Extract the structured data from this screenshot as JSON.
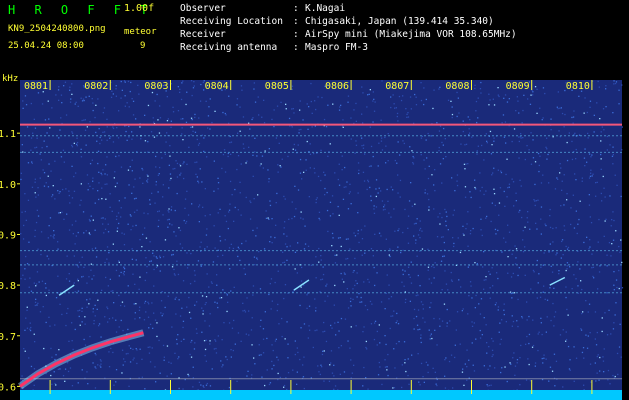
{
  "header": {
    "brand": "H R O F F T",
    "version": "1.00f",
    "filename": "KN9_2504240800.png",
    "meteor_label": "meteor",
    "datetime": "25.04.24 08:00",
    "meteor_count": "9",
    "info": [
      {
        "key": "Observer",
        "value": "K.Nagai"
      },
      {
        "key": "Receiving Location",
        "value": "Chigasaki, Japan (139.414 35.340)"
      },
      {
        "key": "Receiver",
        "value": "AirSpy mini (Miakejima VOR 108.65MHz)"
      },
      {
        "key": "Receiving antenna",
        "value": "Maspro FM-3"
      }
    ]
  },
  "chart_data": {
    "type": "heatmap",
    "title": "",
    "xlabel": "",
    "ylabel": "kHz",
    "x_tick_labels": [
      "0801",
      "0802",
      "0803",
      "0804",
      "0805",
      "0806",
      "0807",
      "0808",
      "0809",
      "0810"
    ],
    "y_tick_labels": [
      "1.1",
      "1.0",
      "0.9",
      "0.8",
      "0.7",
      "0.6"
    ],
    "y_ticks": [
      1.1,
      1.0,
      0.9,
      0.8,
      0.7,
      0.6
    ],
    "ylim": [
      0.585,
      1.205
    ],
    "xlim": [
      0.5,
      10.5
    ],
    "background_color": "#1a2a7a",
    "noise_color": "#3a6cd8",
    "grid_color": "#c8c8c8",
    "tick_color": "#ffff33",
    "horizontal_lines_khz": [
      1.117,
      1.095,
      1.062,
      0.868,
      0.84,
      0.785,
      0.615
    ],
    "strong_carrier_khz": 1.117,
    "meteor_trace": {
      "color": "#ff3366",
      "points": [
        [
          0.5,
          0.6
        ],
        [
          0.8,
          0.625
        ],
        [
          1.1,
          0.645
        ],
        [
          1.4,
          0.662
        ],
        [
          1.7,
          0.676
        ],
        [
          2.0,
          0.688
        ],
        [
          2.3,
          0.698
        ],
        [
          2.55,
          0.706
        ]
      ]
    },
    "short_streaks": [
      [
        [
          1.15,
          0.78
        ],
        [
          1.4,
          0.8
        ]
      ],
      [
        [
          5.05,
          0.79
        ],
        [
          5.3,
          0.81
        ]
      ],
      [
        [
          9.3,
          0.8
        ],
        [
          9.55,
          0.815
        ]
      ]
    ]
  }
}
